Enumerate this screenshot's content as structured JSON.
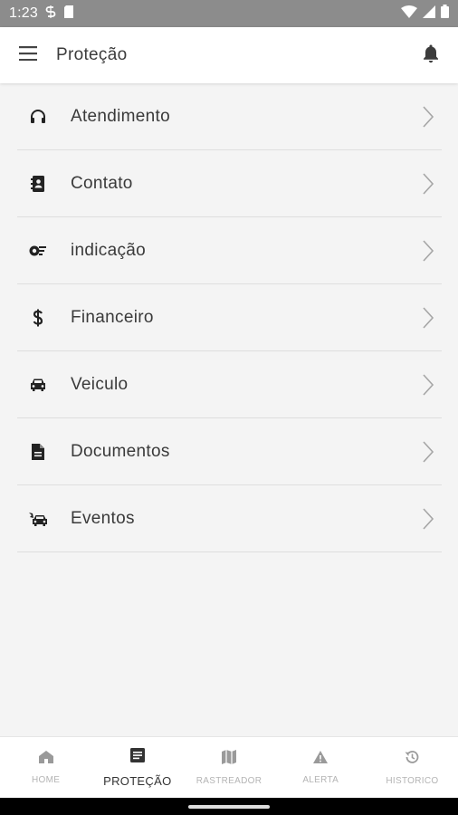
{
  "status_bar": {
    "time": "1:23",
    "icons": [
      "sync-icon",
      "sd-card-icon",
      "wifi-icon",
      "signal-icon",
      "battery-icon"
    ]
  },
  "app_bar": {
    "title": "Proteção",
    "menu_icon": "hamburger-menu-icon",
    "action_icon": "bell-icon"
  },
  "menu_items": [
    {
      "label": "Atendimento",
      "icon": "headphones-icon"
    },
    {
      "label": "Contato",
      "icon": "contact-book-icon"
    },
    {
      "label": "indicação",
      "icon": "referral-icon"
    },
    {
      "label": "Financeiro",
      "icon": "dollar-icon"
    },
    {
      "label": "Veiculo",
      "icon": "car-icon"
    },
    {
      "label": "Documentos",
      "icon": "document-icon"
    },
    {
      "label": "Eventos",
      "icon": "car-crash-icon"
    }
  ],
  "bottom_nav": {
    "items": [
      {
        "label": "HOME",
        "icon": "home-icon",
        "active": false
      },
      {
        "label": "PROTEÇÃO",
        "icon": "article-icon",
        "active": true
      },
      {
        "label": "RASTREADOR",
        "icon": "map-icon",
        "active": false
      },
      {
        "label": "ALERTA",
        "icon": "warning-icon",
        "active": false
      },
      {
        "label": "HISTORICO",
        "icon": "history-icon",
        "active": false
      }
    ]
  },
  "colors": {
    "status_bar": "#8c8c8c",
    "background": "#f4f4f4",
    "app_bar": "#ffffff",
    "text": "#3a3a3a",
    "chevron": "#9e9e9e",
    "nav_inactive": "#b4b4b4",
    "nav_active": "#333333"
  }
}
